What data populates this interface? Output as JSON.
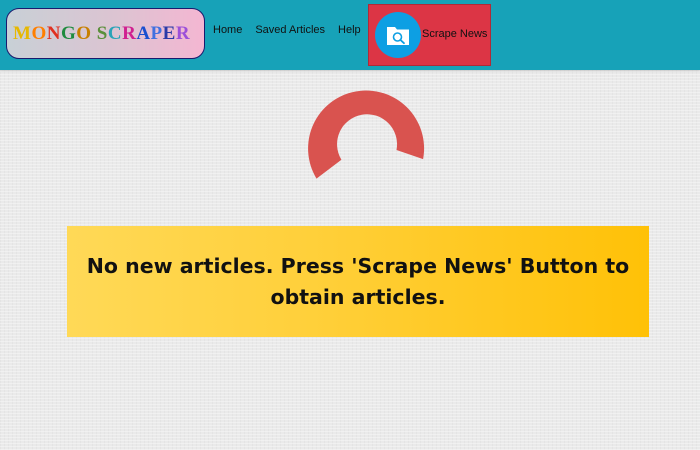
{
  "navbar": {
    "brand": "MONGO SCRAPER",
    "links": [
      "Home",
      "Saved Articles",
      "Help"
    ],
    "scrape_button_label": "Scrape News"
  },
  "icons": {
    "scrape": "folder-search-icon",
    "loading": "loading-spinner-icon"
  },
  "main": {
    "message": "No new articles. Press 'Scrape News' Button to obtain articles."
  },
  "colors": {
    "navbar": "#17a2b8",
    "scrape_button": "#dc3545",
    "scrape_icon": "#0d9fe3",
    "spinner": "#d9534f",
    "message_box": "#ffc107",
    "brand_letters": [
      "#e6b800",
      "#ff7f00",
      "#e03020",
      "#1e8b3e",
      "#c88000",
      "#5a8f3a",
      "#2aa3b8",
      "#d02090",
      "#1a4fd0",
      "#4070e0",
      "#2a3aa8",
      "#9b4fd9"
    ]
  }
}
